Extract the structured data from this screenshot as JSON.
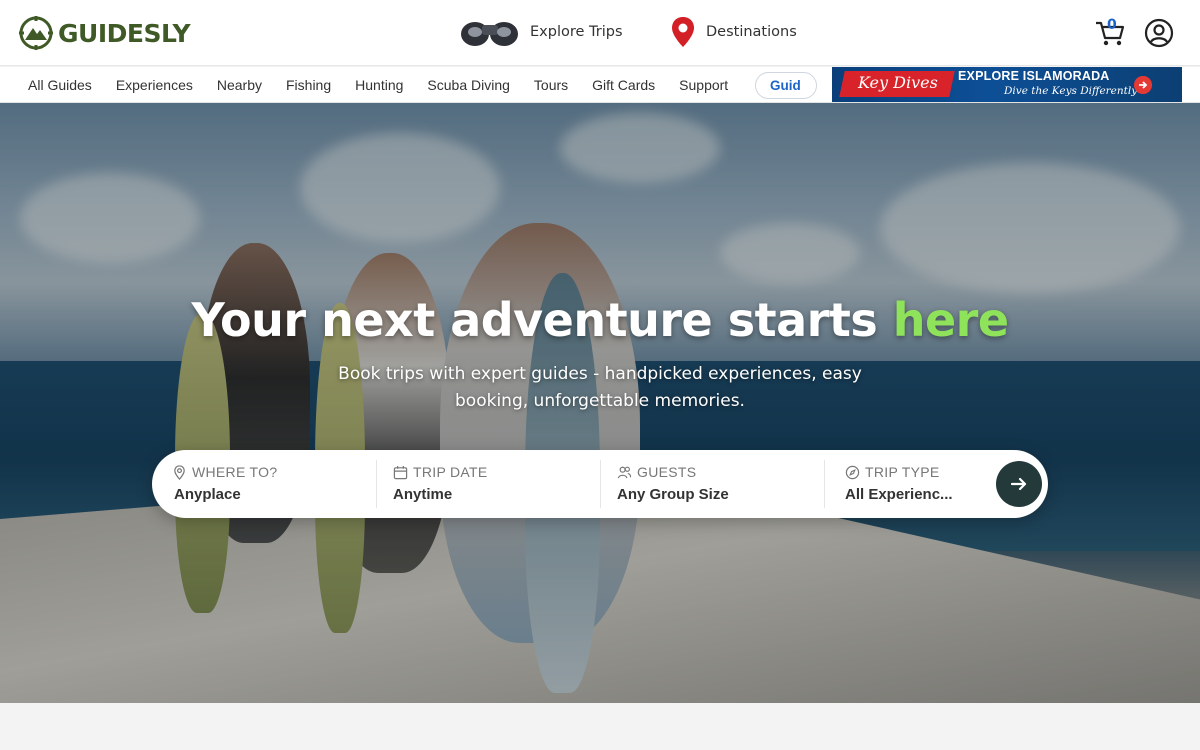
{
  "brand": {
    "name": "GUIDESLY"
  },
  "header": {
    "explore_label": "Explore Trips",
    "destinations_label": "Destinations",
    "cart_count": "0"
  },
  "nav": {
    "items": [
      "All Guides",
      "Experiences",
      "Nearby",
      "Fishing",
      "Hunting",
      "Scuba Diving",
      "Tours",
      "Gift Cards",
      "Support"
    ],
    "pill_label": "Guid"
  },
  "banner": {
    "brand": "Key Dives",
    "title": "EXPLORE ISLAMORADA",
    "subtitle": "Dive the Keys Differently"
  },
  "hero": {
    "title_main": "Your next adventure starts ",
    "title_accent": "here",
    "subtitle": "Book trips with expert guides - handpicked experiences, easy booking, unforgettable memories."
  },
  "search": {
    "where_label": "WHERE TO?",
    "where_value": "Anyplace",
    "date_label": "TRIP DATE",
    "date_value": "Anytime",
    "guests_label": "GUESTS",
    "guests_value": "Any Group Size",
    "type_label": "TRIP TYPE",
    "type_value": "All Experienc..."
  },
  "colors": {
    "brand_green": "#3f5a26",
    "accent_green": "#8fe35b",
    "link_blue": "#1c63c9",
    "search_button": "#23393a"
  }
}
